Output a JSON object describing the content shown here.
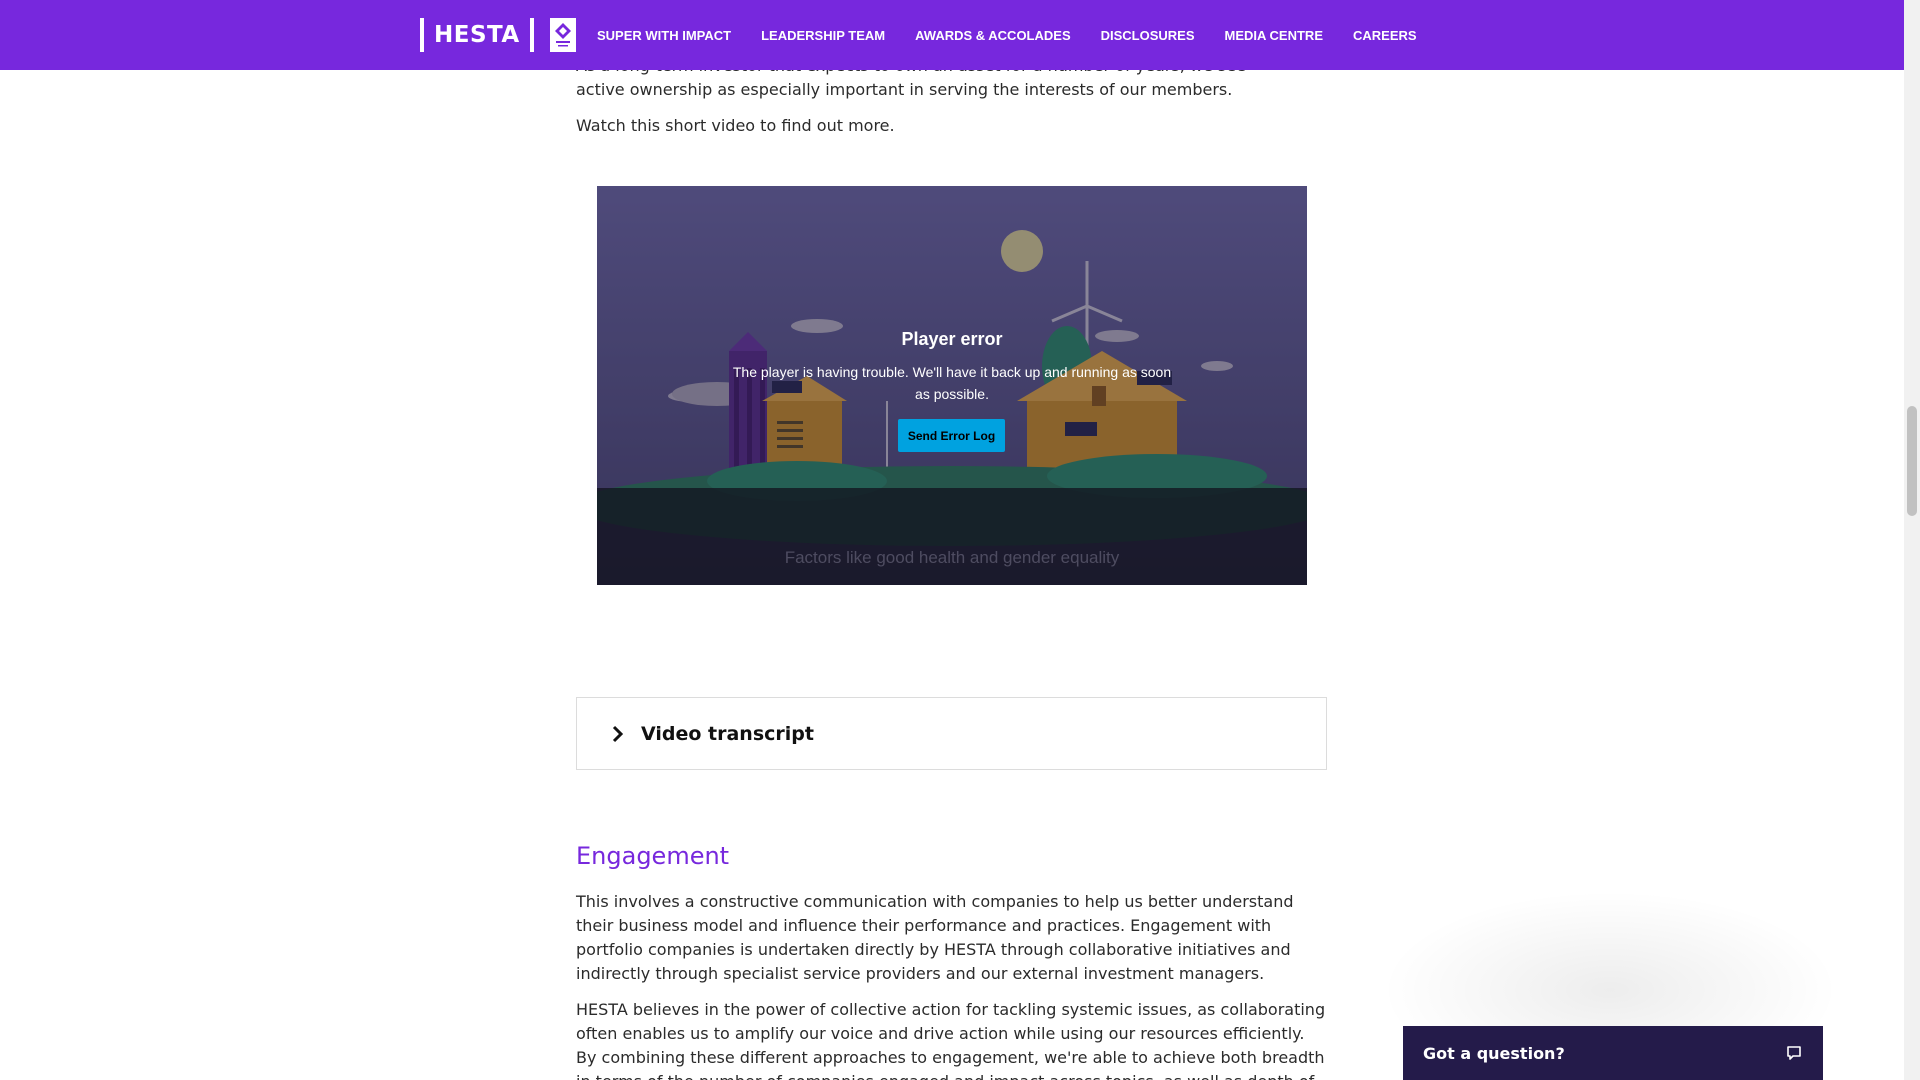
{
  "header": {
    "logo_text": "HESTA",
    "nav": [
      "SUPER WITH IMPACT",
      "LEADERSHIP TEAM",
      "AWARDS & ACCOLADES",
      "DISCLOSURES",
      "MEDIA CENTRE",
      "CAREERS"
    ],
    "brand_color": "#7728dd"
  },
  "content": {
    "intro_partial": "As a long-term investor that expects to own an asset for a number of years, we see active ownership as especially important in serving the interests of our members.",
    "watch_text": "Watch this short video to find out more."
  },
  "video": {
    "error_title": "Player error",
    "error_message": "The player is having trouble. We'll have it back up and running as soon as possible.",
    "send_error_label": "Send Error Log",
    "caption": "Factors like good health and gender equality",
    "button_color": "#00a2e0"
  },
  "transcript": {
    "label": "Video transcript",
    "icon": "chevron-right-icon"
  },
  "engagement": {
    "heading": "Engagement",
    "para1": "This involves a constructive communication with companies to help us better understand their business model and influence their performance and practices. Engagement with portfolio companies is undertaken directly by HESTA through collaborative initiatives and indirectly through specialist service providers and our external investment managers.",
    "para2": "HESTA believes in the power of collective action for tackling systemic issues, as collaborating often enables us to amplify our voice and drive action while using our resources efficiently. By combining these different approaches to engagement, we're able to achieve both breadth in terms of the number of companies engaged and impact across topics, as well as depth of engagement."
  },
  "chat": {
    "label": "Got a question?",
    "icon": "chat-bubble-icon",
    "bg_color": "#241b4a"
  }
}
